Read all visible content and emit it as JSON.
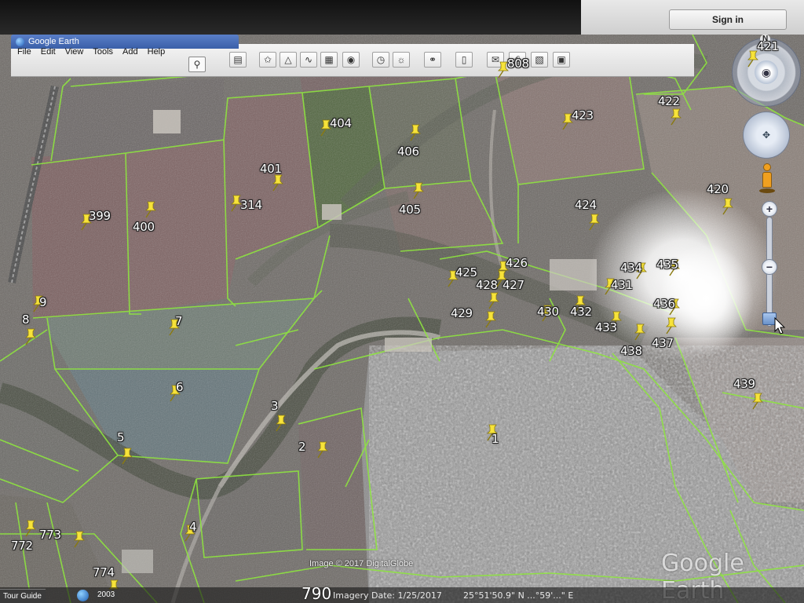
{
  "window": {
    "title": "Google Earth",
    "signin_label": "Sign in"
  },
  "menu": [
    "File",
    "Edit",
    "View",
    "Tools",
    "Add",
    "Help"
  ],
  "toolbar": {
    "icons": [
      "sidebar-toggle-icon",
      "add-placemark-icon",
      "add-polygon-icon",
      "add-path-icon",
      "add-image-overlay-icon",
      "record-tour-icon",
      "historical-imagery-icon",
      "sunlight-icon",
      "planets-icon",
      "ruler-icon",
      "email-icon",
      "print-icon",
      "save-image-icon",
      "view-in-maps-icon"
    ]
  },
  "navigation": {
    "north_label": "N",
    "zoom_plus": "+",
    "zoom_minus": "−"
  },
  "placemarks": [
    {
      "label": "808"
    },
    {
      "label": "404"
    },
    {
      "label": "406"
    },
    {
      "label": "423"
    },
    {
      "label": "422"
    },
    {
      "label": "401"
    },
    {
      "label": "314"
    },
    {
      "label": "399"
    },
    {
      "label": "400"
    },
    {
      "label": "405"
    },
    {
      "label": "424"
    },
    {
      "label": "420"
    },
    {
      "label": "9"
    },
    {
      "label": "8"
    },
    {
      "label": "7"
    },
    {
      "label": "425"
    },
    {
      "label": "426"
    },
    {
      "label": "428"
    },
    {
      "label": "427"
    },
    {
      "label": "429"
    },
    {
      "label": "430"
    },
    {
      "label": "432"
    },
    {
      "label": "431"
    },
    {
      "label": "434"
    },
    {
      "label": "435"
    },
    {
      "label": "436"
    },
    {
      "label": "433"
    },
    {
      "label": "437"
    },
    {
      "label": "438"
    },
    {
      "label": "439"
    },
    {
      "label": "6"
    },
    {
      "label": "3"
    },
    {
      "label": "5"
    },
    {
      "label": "2"
    },
    {
      "label": "1"
    },
    {
      "label": "4"
    },
    {
      "label": "772"
    },
    {
      "label": "773"
    },
    {
      "label": "774"
    },
    {
      "label": "421"
    }
  ],
  "status": {
    "tour_guide": "Tour Guide",
    "year": "2003",
    "imagery_text": "Imagery Date: 1/25/2017",
    "coords_text": "25°51'50.9\" N  ...°59'...\" E",
    "big_number": "790",
    "copyright": "Image © 2017 DigitalGlobe",
    "watermark": "Google Earth"
  }
}
